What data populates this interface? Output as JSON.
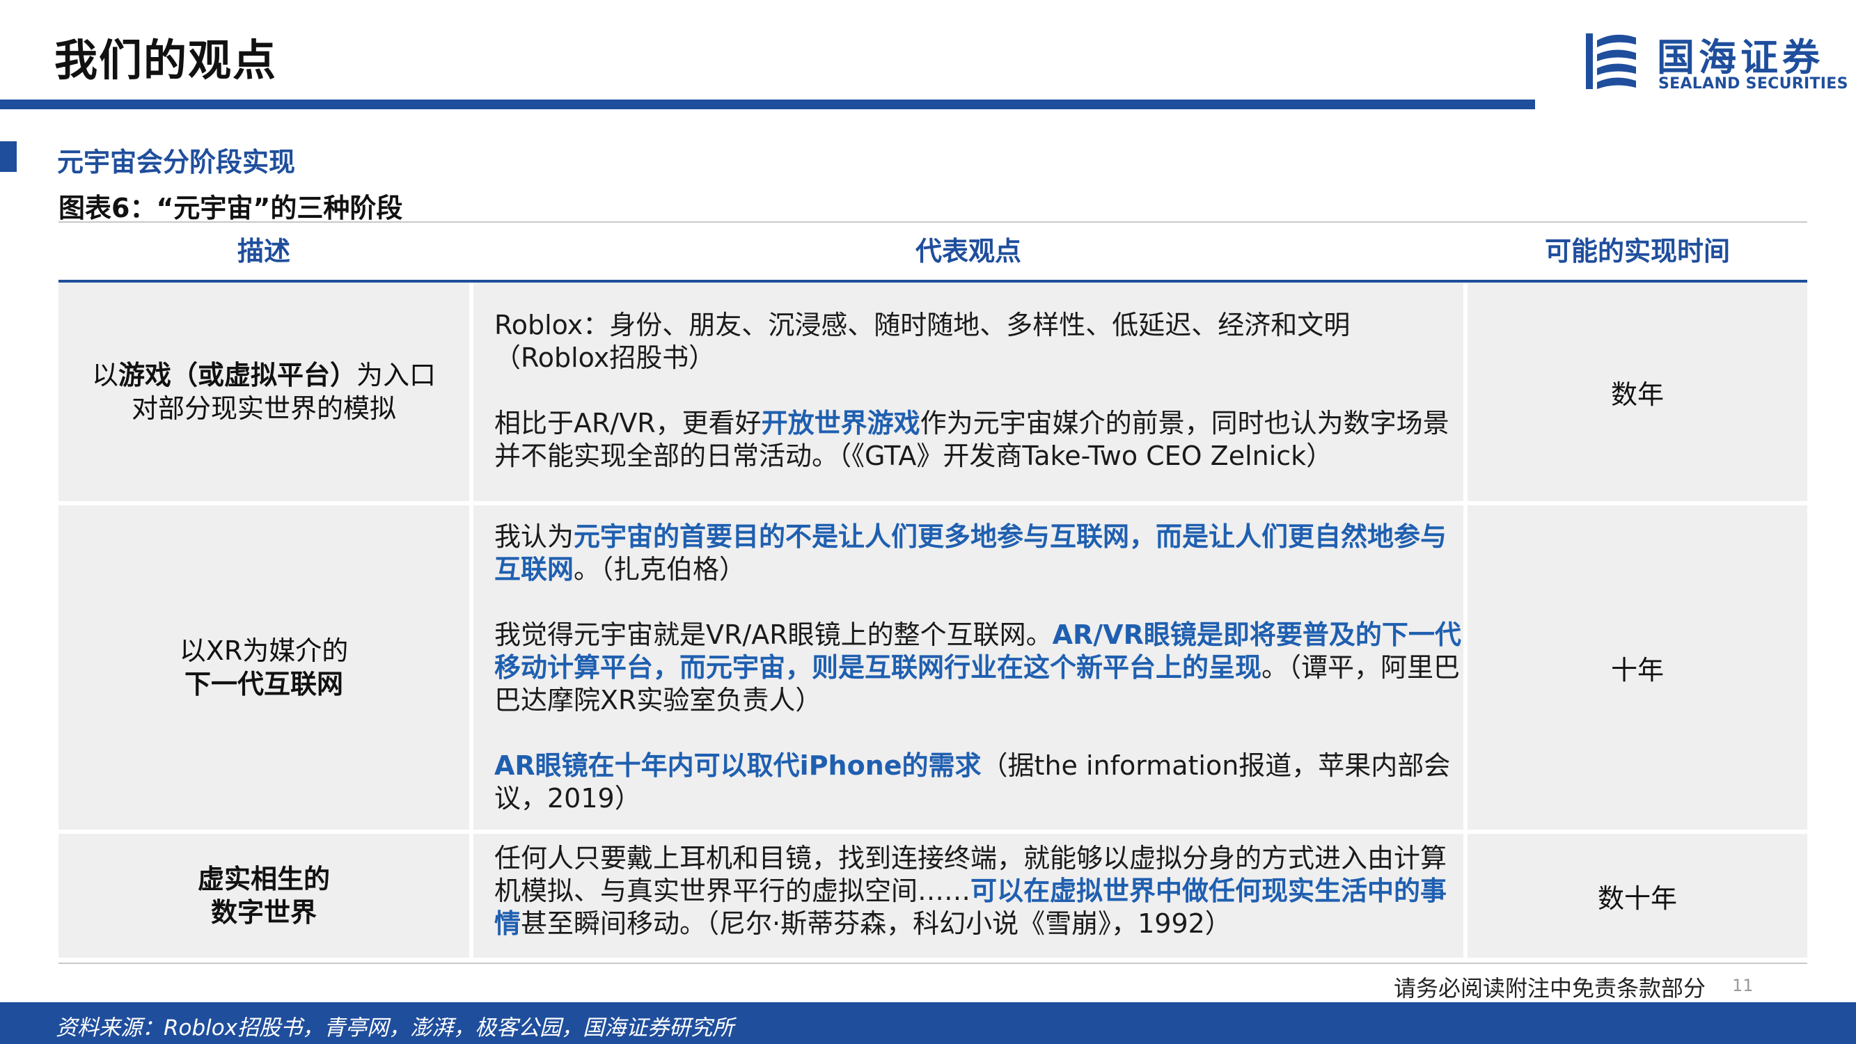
{
  "header": {
    "title": "我们的观点",
    "logo_cn": "国海证券",
    "logo_en": "SEALAND SECURITIES"
  },
  "section": {
    "title": "元宇宙会分阶段实现",
    "figure_title": "图表6：“元宇宙”的三种阶段"
  },
  "table": {
    "headers": [
      "描述",
      "代表观点",
      "可能的实现时间"
    ],
    "rows": [
      {
        "desc": [
          "以",
          "游戏（或虚拟平台）",
          "为入口",
          "对部分现实世界的模拟"
        ],
        "view": {
          "p1": "Roblox：身份、朋友、沉浸感、随时随地、多样性、低延迟、经济和文明（Roblox招股书）",
          "p2_a": "相比于AR/VR，更看好",
          "p2_hl": "开放世界游戏",
          "p2_b": "作为元宇宙媒介的前景，同时也认为数字场景并不能实现全部的日常活动。（《GTA》开发商Take-Two CEO Zelnick）"
        },
        "time": "数年"
      },
      {
        "desc": [
          "以XR为媒介的",
          "下一代互联网"
        ],
        "view": {
          "p1_a": "我认为",
          "p1_hl": "元宇宙的首要目的不是让人们更多地参与互联网，而是让人们更自然地参与互联网",
          "p1_b": "。（扎克伯格）",
          "p2_a": "我觉得元宇宙就是VR/AR眼镜上的整个互联网。",
          "p2_hl": "AR/VR眼镜是即将要普及的下一代移动计算平台，而元宇宙，则是互联网行业在这个新平台上的呈现",
          "p2_b": "。（谭平，阿里巴巴达摩院XR实验室负责人）",
          "p3_hl": "AR眼镜在十年内可以取代iPhone的需求",
          "p3_b": "（据the information报道，苹果内部会议，2019）"
        },
        "time": "十年"
      },
      {
        "desc": [
          "虚实相生的",
          "数字世界"
        ],
        "view": {
          "p1_a": "任何人只要戴上耳机和目镜，找到连接终端，就能够以虚拟分身的方式进入由计算机模拟、与真实世界平行的虚拟空间……",
          "p1_hl": "可以在虚拟世界中做任何现实生活中的事情",
          "p1_b": "甚至瞬间移动。（尼尔·斯蒂芬森，科幻小说《雪崩》，1992）"
        },
        "time": "数十年"
      }
    ]
  },
  "footer": {
    "disclaimer": "请务必阅读附注中免责条款部分",
    "page": "11",
    "source": "资料来源：Roblox招股书，青亭网，澎湃，极客公园，国海证券研究所"
  }
}
